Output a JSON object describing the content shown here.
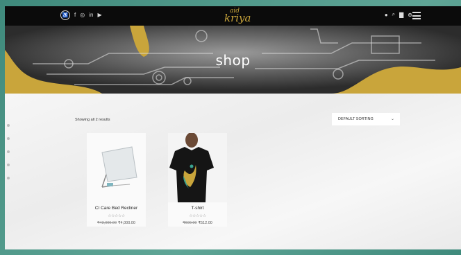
{
  "colors": {
    "frame": "#4a8f82",
    "nav": "#0b0b0b",
    "accent": "#c9a53b",
    "page": "#f2f2f2"
  },
  "nav": {
    "social_icons": [
      "accessibility-icon",
      "facebook-icon",
      "instagram-icon",
      "linkedin-icon",
      "youtube-icon"
    ],
    "social_glyphs": {
      "facebook": "f",
      "instagram": "◎",
      "linkedin": "in",
      "youtube": "▶"
    },
    "logo_top": "aid",
    "logo_main": "kriya",
    "right_icons": [
      "user-icon",
      "search-icon",
      "cart-icon",
      "globe-icon",
      "menu-icon"
    ],
    "right_glyphs": {
      "user": "●",
      "search": "⌕",
      "cart": "▇",
      "globe": "⊕"
    }
  },
  "hero": {
    "title": "shop"
  },
  "shop": {
    "results_text": "Showing all 2 results",
    "sort_label": "DEFAULT SORTING",
    "sort_chevron": "⌄"
  },
  "products": [
    {
      "name": "CI Care Bed Recliner",
      "stars": "☆☆☆☆☆",
      "old_price": "₹43,000.00",
      "price": "₹4,000.00"
    },
    {
      "name": "T-shirt",
      "stars": "☆☆☆☆☆",
      "old_price": "₹600.00",
      "price": "₹512.00"
    }
  ]
}
